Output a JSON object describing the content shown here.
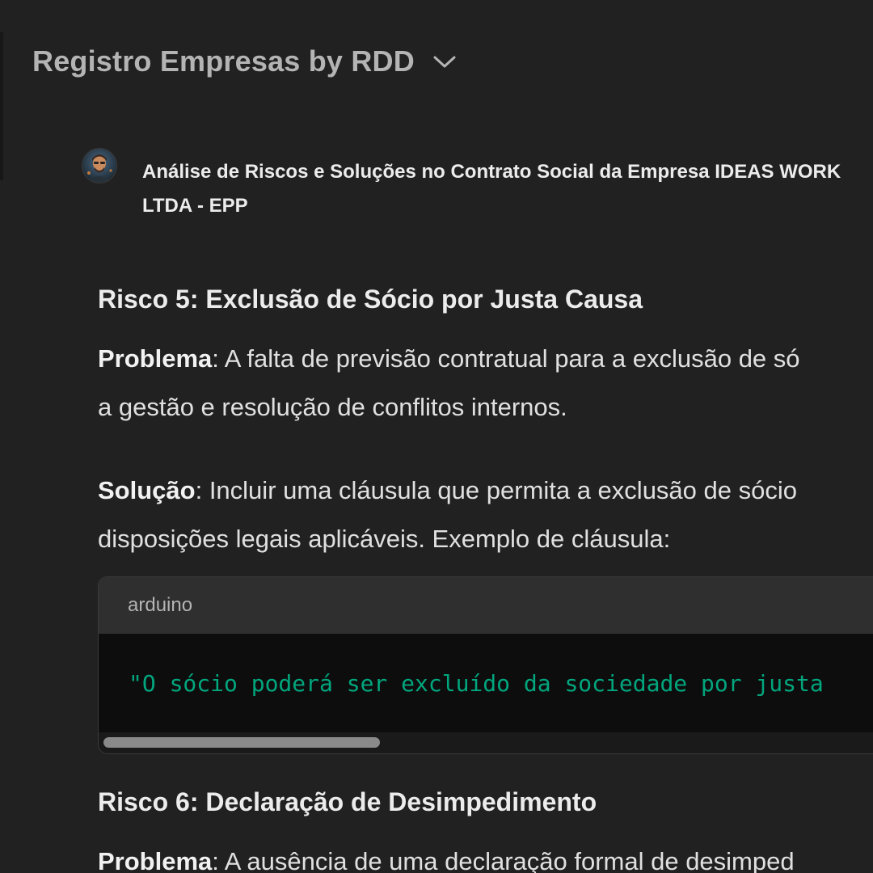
{
  "header": {
    "title": "Registro Empresas by RDD",
    "chevron_icon": "chevron-down-icon"
  },
  "conversation": {
    "avatar_icon": "avatar-portrait",
    "title_line1": "Análise de Riscos e Soluções no Contrato Social da Empresa IDEAS WORK",
    "title_line2": "LTDA - EPP"
  },
  "risk5": {
    "prefix": "Risco 5: ",
    "title": "Exclusão de Sócio por Justa Causa",
    "problem_label": "Problema",
    "problem_line1": ": A falta de previsão contratual para a exclusão de só",
    "problem_line2": "a gestão e resolução de conflitos internos.",
    "solution_label": "Solução",
    "solution_line1": ": Incluir uma cláusula que permita a exclusão de sócio",
    "solution_line2": "disposições legais aplicáveis. Exemplo de cláusula:"
  },
  "code_block": {
    "language": "arduino",
    "code": "\"O sócio poderá ser excluído da sociedade por justa"
  },
  "risk6": {
    "prefix": "Risco 6: ",
    "title": "Declaração de Desimpedimento",
    "problem_label": "Problema",
    "problem_line1": ": A ausência de uma declaração formal de desimped"
  },
  "colors": {
    "background": "#212121",
    "code_text": "#00a67d",
    "header_text": "#b4b4b4"
  }
}
